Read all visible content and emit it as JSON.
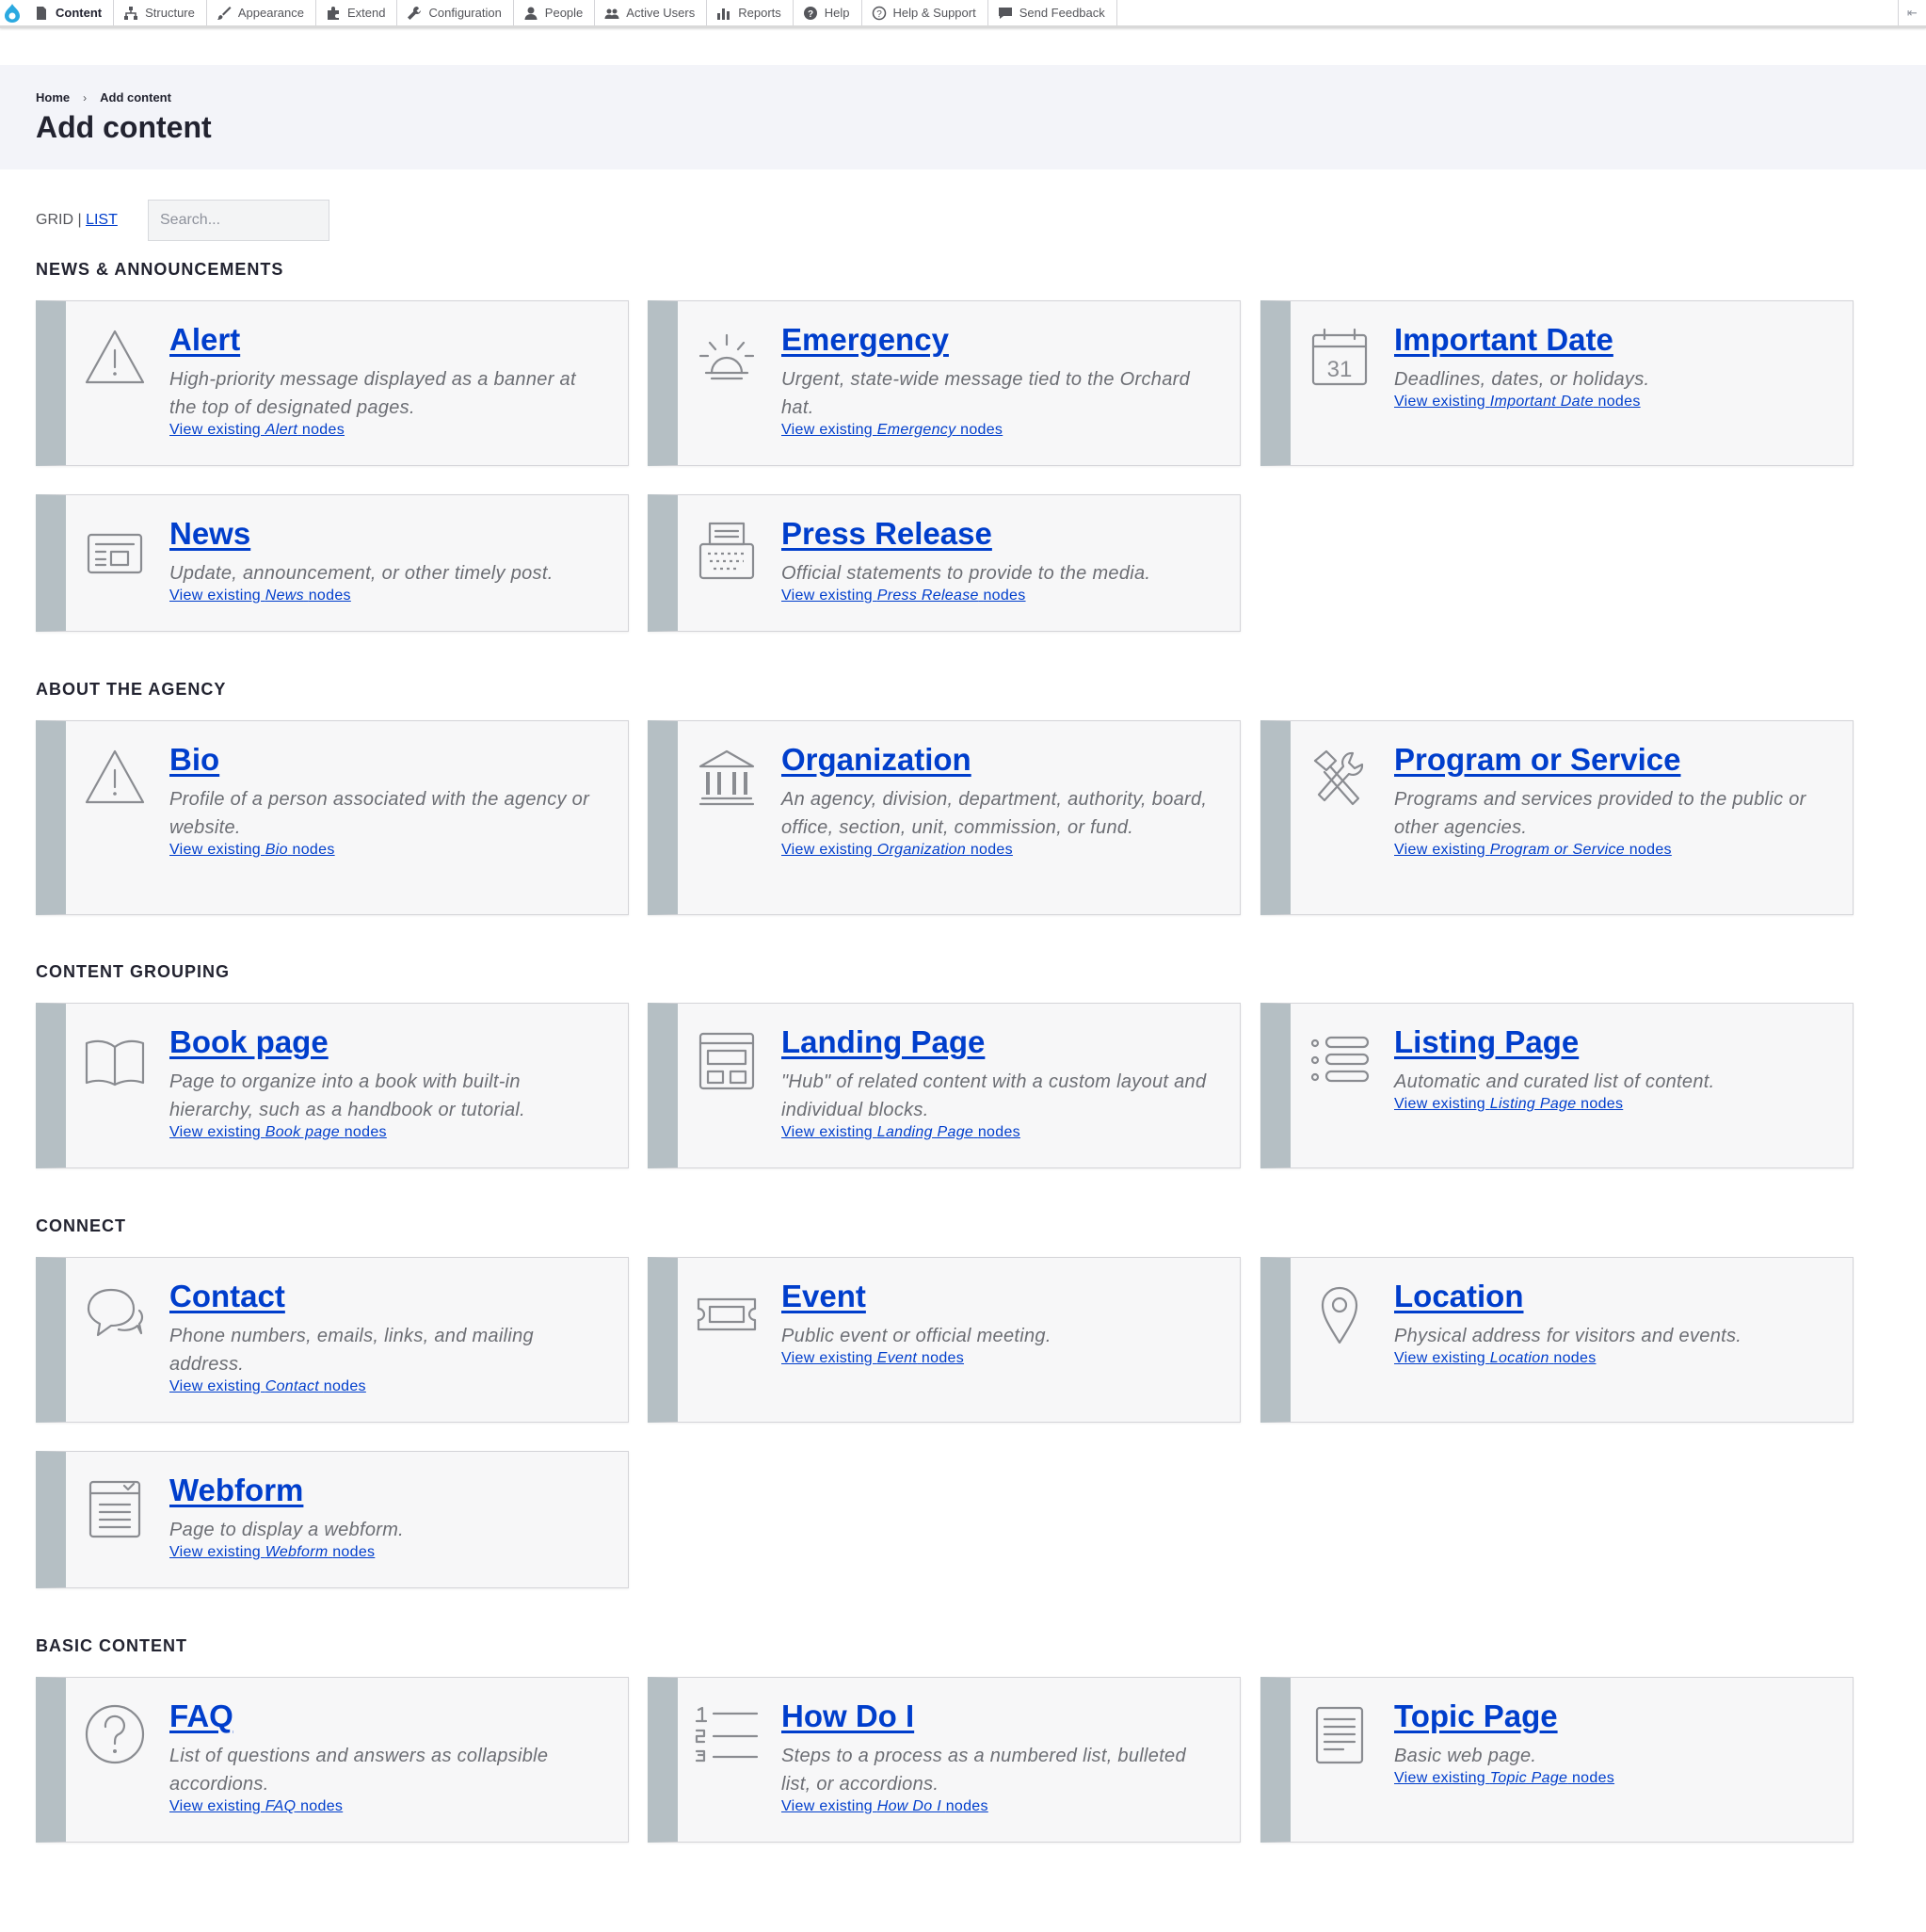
{
  "toolbar": {
    "items": [
      {
        "label": "Content"
      },
      {
        "label": "Structure"
      },
      {
        "label": "Appearance"
      },
      {
        "label": "Extend"
      },
      {
        "label": "Configuration"
      },
      {
        "label": "People"
      },
      {
        "label": "Active Users"
      },
      {
        "label": "Reports"
      },
      {
        "label": "Help"
      },
      {
        "label": "Help & Support"
      },
      {
        "label": "Send Feedback"
      }
    ]
  },
  "breadcrumb": {
    "home": "Home",
    "sep": "›",
    "current": "Add content"
  },
  "page": {
    "title": "Add content"
  },
  "view": {
    "grid": "GRID",
    "divider": "|",
    "list": "LIST"
  },
  "search": {
    "placeholder": "Search...",
    "value": ""
  },
  "link_prefix": "View existing",
  "link_suffix": "nodes",
  "sections": [
    {
      "title": "NEWS & ANNOUNCEMENTS"
    },
    {
      "title": "ABOUT THE AGENCY"
    },
    {
      "title": "CONTENT GROUPING"
    },
    {
      "title": "CONNECT"
    },
    {
      "title": "BASIC CONTENT"
    }
  ],
  "cards": [
    {
      "title": "Alert",
      "icon": "warning-icon",
      "desc": "High-priority message displayed as a banner at the top of designated pages.",
      "link_name": "Alert"
    },
    {
      "title": "Emergency",
      "icon": "siren-icon",
      "desc": "Urgent, state-wide message tied to the Orchard hat.",
      "link_name": "Emergency"
    },
    {
      "title": "Important Date",
      "icon": "calendar-icon",
      "desc": "Deadlines, dates, or holidays.",
      "link_name": "Important Date"
    },
    {
      "title": "News",
      "icon": "newspaper-icon",
      "desc": "Update, announcement, or other timely post.",
      "link_name": "News"
    },
    {
      "title": "Press Release",
      "icon": "typewriter-icon",
      "desc": "Official statements to provide to the media.",
      "link_name": "Press Release"
    },
    {
      "title": "Bio",
      "icon": "warning-icon",
      "desc": "Profile of a person associated with the agency or website.",
      "link_name": "Bio"
    },
    {
      "title": "Organization",
      "icon": "building-icon",
      "desc": "An agency, division, department, authority, board, office, section, unit, commission, or fund.",
      "link_name": "Organization"
    },
    {
      "title": "Program or Service",
      "icon": "tools-icon",
      "desc": "Programs and services provided to the public or other agencies.",
      "link_name": "Program or Service"
    },
    {
      "title": "Book page",
      "icon": "book-icon",
      "desc": "Page to organize into a book with built-in hierarchy, such as a handbook or tutorial.",
      "link_name": "Book page"
    },
    {
      "title": "Landing Page",
      "icon": "layout-icon",
      "desc": "\"Hub\" of related content with a custom layout and individual blocks.",
      "link_name": "Landing Page"
    },
    {
      "title": "Listing Page",
      "icon": "list-icon",
      "desc": "Automatic and curated list of content.",
      "link_name": "Listing Page"
    },
    {
      "title": "Contact",
      "icon": "chat-bubbles-icon",
      "desc": "Phone numbers, emails, links, and mailing address.",
      "link_name": "Contact"
    },
    {
      "title": "Event",
      "icon": "ticket-icon",
      "desc": "Public event or official meeting.",
      "link_name": "Event"
    },
    {
      "title": "Location",
      "icon": "map-pin-icon",
      "desc": "Physical address for visitors and events.",
      "link_name": "Location"
    },
    {
      "title": "Webform",
      "icon": "form-icon",
      "desc": "Page to display a webform.",
      "link_name": "Webform"
    },
    {
      "title": "FAQ",
      "icon": "question-icon",
      "desc": "List of questions and answers as collapsible accordions.",
      "link_name": "FAQ"
    },
    {
      "title": "How Do I",
      "icon": "numbered-list-icon",
      "desc": "Steps to a process as a numbered list, bulleted list, or accordions.",
      "link_name": "How Do I"
    },
    {
      "title": "Topic Page",
      "icon": "document-icon",
      "desc": "Basic web page.",
      "link_name": "Topic Page"
    }
  ]
}
